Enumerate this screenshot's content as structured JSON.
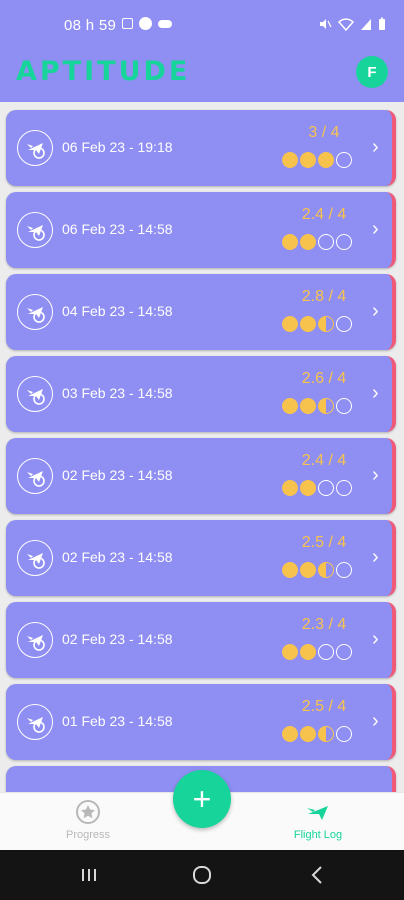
{
  "status_bar": {
    "time": "08 h 59"
  },
  "header": {
    "title": "APTITUDE",
    "avatar_letter": "F"
  },
  "flight_log": [
    {
      "date": "06 Feb 23 - 19:18",
      "score": "3 / 4",
      "rating": 3
    },
    {
      "date": "06 Feb 23 - 14:58",
      "score": "2.4 / 4",
      "rating": 2
    },
    {
      "date": "04 Feb 23 - 14:58",
      "score": "2.8 / 4",
      "rating": 2.5
    },
    {
      "date": "03 Feb 23 - 14:58",
      "score": "2.6 / 4",
      "rating": 2.5
    },
    {
      "date": "02 Feb 23 - 14:58",
      "score": "2.4 / 4",
      "rating": 2
    },
    {
      "date": "02 Feb 23 - 14:58",
      "score": "2.5 / 4",
      "rating": 2.5
    },
    {
      "date": "02 Feb 23 - 14:58",
      "score": "2.3 / 4",
      "rating": 2
    },
    {
      "date": "01 Feb 23 - 14:58",
      "score": "2.5 / 4",
      "rating": 2.5
    }
  ],
  "fab": {
    "label": "+"
  },
  "bottom_nav": {
    "progress_label": "Progress",
    "flight_log_label": "Flight Log",
    "active": "Flight Log"
  },
  "colors": {
    "accent": "#17d49b",
    "card": "#8f8ef2",
    "star": "#f8c34d",
    "edge": "#f05a78"
  }
}
